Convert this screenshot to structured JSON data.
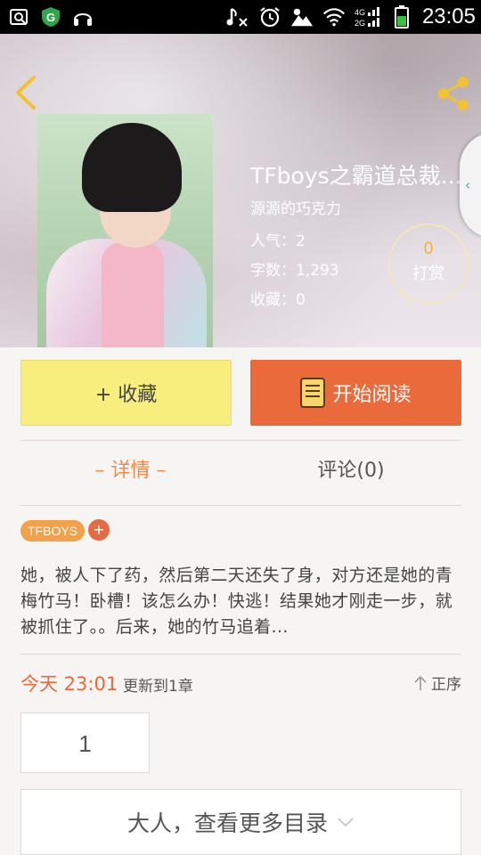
{
  "status_bar": {
    "time": "23:05",
    "icons": [
      "image-icon",
      "security-app-icon",
      "headphones-icon",
      "music-mute-icon",
      "alarm-icon",
      "weather-icon",
      "wifi-icon",
      "signal-4g-2g-icon",
      "battery-icon"
    ]
  },
  "header": {
    "back_icon": "chevron-left-icon",
    "share_icon": "share-icon"
  },
  "book": {
    "title": "TFboys之霸道总裁...",
    "author": "源源的巧克力",
    "popularity": "人气：2",
    "word_count": "字数：1,293",
    "favorites": "收藏：0",
    "tip": {
      "count": "0",
      "label": "打赏"
    },
    "tag": "TFBOYS",
    "tag_add": "+",
    "description": "她，被人下了药，然后第二天还失了身，对方还是她的青梅竹马！卧槽！该怎么办！快逃！结果她才刚走一步，就被抓住了。。后来，她的竹马追着..."
  },
  "actions": {
    "collect_label": "+ 收藏",
    "read_label": "开始阅读"
  },
  "tabs": {
    "detail": "– 详情 –",
    "comment": "评论(0)"
  },
  "update": {
    "time": "今天 23:01",
    "text": "更新到1章",
    "order_label": "正序"
  },
  "chapter": {
    "number": "1"
  },
  "more_label": "大人，查看更多目录",
  "colors": {
    "accent_orange": "#ea6a3c",
    "collect_yellow": "#f8ee7d",
    "tag_orange": "#f3a14a",
    "tip_gold": "#f3b336"
  }
}
